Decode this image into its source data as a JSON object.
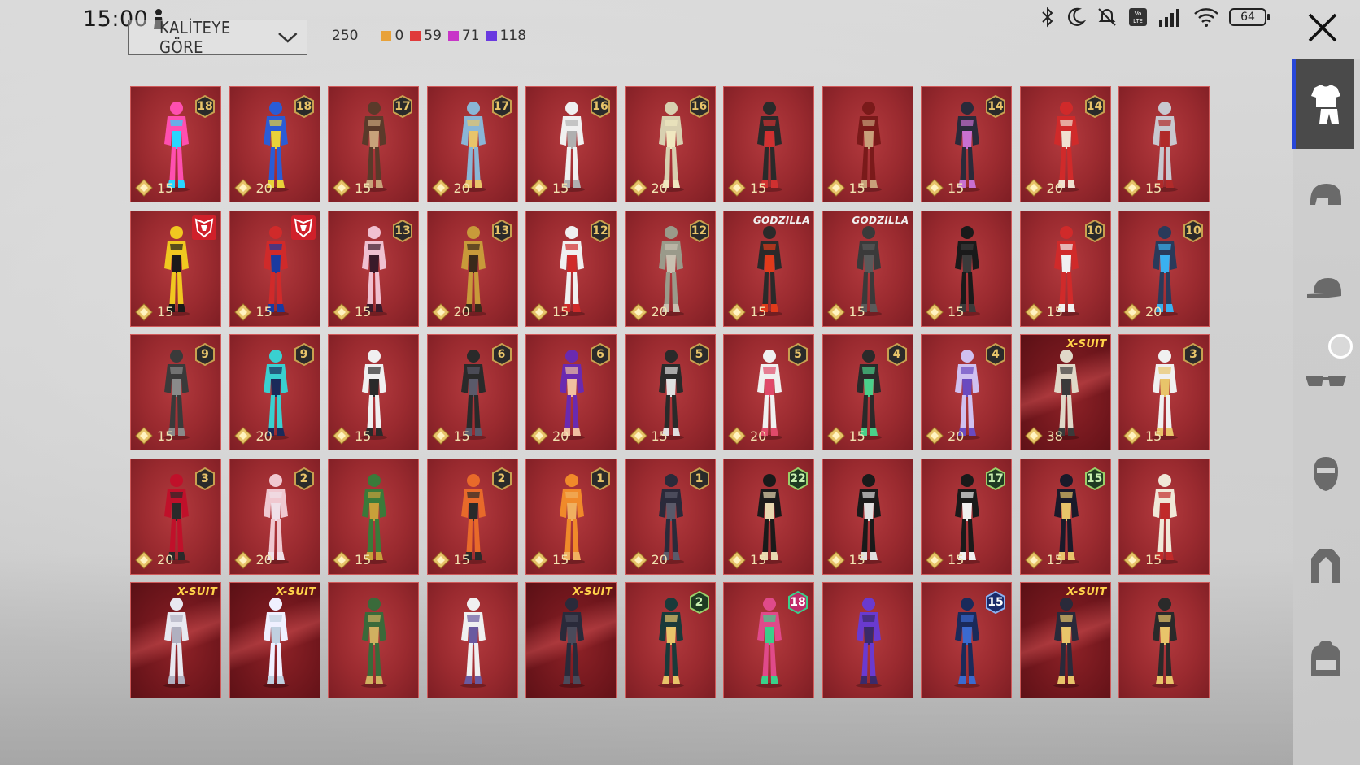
{
  "status_bar": {
    "time": "15:00",
    "battery": "64",
    "icons": [
      "bluetooth-icon",
      "moon-icon",
      "mute-icon",
      "volte-icon",
      "signal-icon",
      "wifi-icon",
      "battery-icon"
    ]
  },
  "header": {
    "sort_label": "KALİTEYE GÖRE",
    "total_count": "250",
    "rarity_counts": [
      {
        "value": "0",
        "color": "#e8a23a"
      },
      {
        "value": "59",
        "color": "#e03a3a"
      },
      {
        "value": "71",
        "color": "#c836c8"
      },
      {
        "value": "118",
        "color": "#6a3ae0"
      }
    ]
  },
  "colors": {
    "card_red": "#9a2a2f",
    "sidebar_active_bar": "#2747d8",
    "badge_gold": "#e8c46a"
  },
  "items": [
    {
      "badge": "18",
      "price": "15",
      "palette": [
        "#ff4fb0",
        "#2ad6ff"
      ]
    },
    {
      "badge": "18",
      "price": "20",
      "palette": [
        "#2a5cd6",
        "#e8d23a"
      ]
    },
    {
      "badge": "17",
      "price": "15",
      "palette": [
        "#5a3a2a",
        "#c8a27a"
      ]
    },
    {
      "badge": "17",
      "price": "20",
      "palette": [
        "#8ab6d6",
        "#e8c46a"
      ]
    },
    {
      "badge": "16",
      "price": "15",
      "palette": [
        "#f0f0f0",
        "#b0b0b0"
      ]
    },
    {
      "badge": "16",
      "price": "20",
      "palette": [
        "#d8d0b0",
        "#f0e8c0"
      ]
    },
    {
      "badge": "",
      "price": "15",
      "palette": [
        "#2a2a2a",
        "#d03030"
      ]
    },
    {
      "badge": "",
      "price": "15",
      "palette": [
        "#7a1a1a",
        "#c8a07a"
      ]
    },
    {
      "badge": "14",
      "price": "15",
      "palette": [
        "#2a2a3a",
        "#c870d0"
      ]
    },
    {
      "badge": "14",
      "price": "20",
      "palette": [
        "#d02a2a",
        "#f0e0d0"
      ]
    },
    {
      "badge": "",
      "price": "15",
      "palette": [
        "#c8c8d0",
        "#b02a2a"
      ]
    },
    {
      "tag": "transformers",
      "price": "15",
      "palette": [
        "#f0c820",
        "#1a1a1a"
      ]
    },
    {
      "tag": "transformers",
      "price": "15",
      "palette": [
        "#d02a2a",
        "#1a3aa0"
      ]
    },
    {
      "badge": "13",
      "price": "15",
      "palette": [
        "#f0c0d0",
        "#3a1a2a"
      ]
    },
    {
      "badge": "13",
      "price": "20",
      "palette": [
        "#c89a3a",
        "#3a2a1a"
      ]
    },
    {
      "badge": "12",
      "price": "15",
      "palette": [
        "#f0f0f0",
        "#d02a2a"
      ]
    },
    {
      "badge": "12",
      "price": "20",
      "palette": [
        "#9a9a8a",
        "#c8c0b0"
      ]
    },
    {
      "tag": "GODZILLA",
      "price": "15",
      "palette": [
        "#2a2a2a",
        "#e03a1a"
      ]
    },
    {
      "tag": "GODZILLA",
      "price": "15",
      "palette": [
        "#3a3a3a",
        "#5a5a5a"
      ]
    },
    {
      "badge": "",
      "price": "15",
      "palette": [
        "#1a1a1a",
        "#3a3a3a"
      ]
    },
    {
      "badge": "10",
      "price": "15",
      "palette": [
        "#d02a2a",
        "#f0f0f0"
      ]
    },
    {
      "badge": "10",
      "price": "20",
      "palette": [
        "#2a3a5a",
        "#3ab0f0"
      ]
    },
    {
      "badge": "9",
      "price": "15",
      "palette": [
        "#3a3a3a",
        "#8a8a8a"
      ]
    },
    {
      "badge": "9",
      "price": "20",
      "palette": [
        "#3ad0d0",
        "#1a2a5a"
      ]
    },
    {
      "badge": "",
      "price": "15",
      "palette": [
        "#f0f0f0",
        "#2a2a2a"
      ]
    },
    {
      "badge": "6",
      "price": "15",
      "palette": [
        "#2a2a2a",
        "#5a5a6a"
      ]
    },
    {
      "badge": "6",
      "price": "20",
      "palette": [
        "#6a2ab0",
        "#f0c0a0"
      ]
    },
    {
      "badge": "5",
      "price": "15",
      "palette": [
        "#2a2a2a",
        "#e0e0e0"
      ]
    },
    {
      "badge": "5",
      "price": "20",
      "palette": [
        "#f0f0f0",
        "#e04a6a"
      ]
    },
    {
      "badge": "4",
      "price": "15",
      "palette": [
        "#2a2a2a",
        "#4ad08a"
      ]
    },
    {
      "badge": "4",
      "price": "20",
      "palette": [
        "#d0c0f0",
        "#6a4ac0"
      ]
    },
    {
      "tag": "X-SUIT",
      "xsuit": true,
      "price": "38",
      "palette": [
        "#e0d8c8",
        "#3a3a3a"
      ]
    },
    {
      "badge": "3",
      "price": "15",
      "palette": [
        "#f0f0f0",
        "#e8c46a"
      ]
    },
    {
      "badge": "3",
      "price": "20",
      "palette": [
        "#c0102a",
        "#2a2a2a"
      ]
    },
    {
      "badge": "2",
      "price": "20",
      "palette": [
        "#f0c8d0",
        "#f0e0e8"
      ]
    },
    {
      "badge": "",
      "price": "15",
      "palette": [
        "#3a7a3a",
        "#c8a03a"
      ]
    },
    {
      "badge": "2",
      "price": "15",
      "palette": [
        "#e86a2a",
        "#2a2a2a"
      ]
    },
    {
      "badge": "1",
      "price": "15",
      "palette": [
        "#f08a2a",
        "#f0b060"
      ]
    },
    {
      "badge": "1",
      "price": "20",
      "palette": [
        "#2a2a3a",
        "#5a5a6a"
      ]
    },
    {
      "badge": "22",
      "badge_style": "green",
      "price": "15",
      "palette": [
        "#1a1a1a",
        "#e8d8b0"
      ]
    },
    {
      "badge": "",
      "price": "15",
      "palette": [
        "#1a1a1a",
        "#e0e0e0"
      ]
    },
    {
      "badge": "17",
      "badge_style": "green",
      "price": "15",
      "palette": [
        "#1a1a1a",
        "#f0f0f0"
      ]
    },
    {
      "badge": "15",
      "badge_style": "green",
      "price": "15",
      "palette": [
        "#1a1a2a",
        "#e8c46a"
      ]
    },
    {
      "badge": "",
      "price": "15",
      "palette": [
        "#f0e8d8",
        "#c02a2a"
      ]
    },
    {
      "tag": "X-SUIT",
      "xsuit": true,
      "price": "",
      "palette": [
        "#e8e8f0",
        "#b0b0c0"
      ]
    },
    {
      "tag": "X-SUIT",
      "xsuit": true,
      "price": "",
      "palette": [
        "#f0f0ff",
        "#c0d0e0"
      ]
    },
    {
      "badge": "",
      "price": "",
      "palette": [
        "#3a6a3a",
        "#d0b060"
      ]
    },
    {
      "badge": "",
      "price": "",
      "palette": [
        "#f0f0f0",
        "#6a5aa0"
      ]
    },
    {
      "tag": "X-SUIT",
      "xsuit": true,
      "price": "",
      "palette": [
        "#2a2a3a",
        "#4a4a5a"
      ]
    },
    {
      "badge": "2",
      "badge_style": "green",
      "price": "",
      "palette": [
        "#1a3a3a",
        "#e8c46a"
      ]
    },
    {
      "badge": "18",
      "badge_style": "pink",
      "price": "",
      "palette": [
        "#e04a8a",
        "#3ad08a"
      ]
    },
    {
      "badge": "",
      "price": "",
      "palette": [
        "#6a3ad0",
        "#3a2a6a"
      ]
    },
    {
      "badge": "15",
      "badge_style": "blue",
      "price": "",
      "palette": [
        "#1a2a5a",
        "#3a6ad0"
      ]
    },
    {
      "tag": "X-SUIT",
      "xsuit": true,
      "price": "",
      "palette": [
        "#2a2a3a",
        "#e8c46a"
      ]
    },
    {
      "badge": "",
      "price": "",
      "palette": [
        "#2a2a2a",
        "#e8c46a"
      ]
    }
  ],
  "sidebar": {
    "categories": [
      {
        "icon": "outfit-icon",
        "active": true
      },
      {
        "icon": "helmet-icon",
        "active": false
      },
      {
        "icon": "cap-icon",
        "active": false
      },
      {
        "icon": "glasses-icon",
        "active": false
      },
      {
        "icon": "mask-icon",
        "active": false
      },
      {
        "icon": "jacket-icon",
        "active": false
      },
      {
        "icon": "backpack-icon",
        "active": false
      }
    ]
  }
}
